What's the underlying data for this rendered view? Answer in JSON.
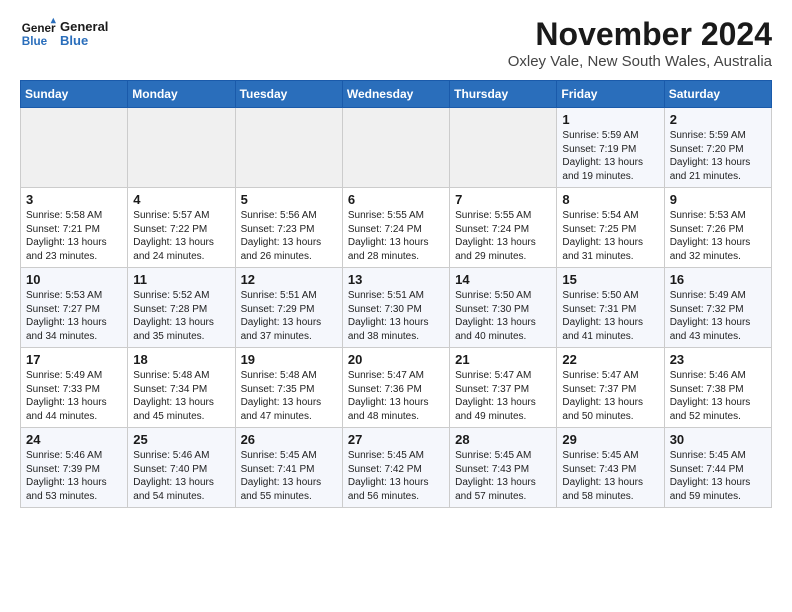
{
  "logo": {
    "line1": "General",
    "line2": "Blue"
  },
  "title": "November 2024",
  "location": "Oxley Vale, New South Wales, Australia",
  "headers": [
    "Sunday",
    "Monday",
    "Tuesday",
    "Wednesday",
    "Thursday",
    "Friday",
    "Saturday"
  ],
  "weeks": [
    [
      {
        "day": "",
        "info": ""
      },
      {
        "day": "",
        "info": ""
      },
      {
        "day": "",
        "info": ""
      },
      {
        "day": "",
        "info": ""
      },
      {
        "day": "",
        "info": ""
      },
      {
        "day": "1",
        "info": "Sunrise: 5:59 AM\nSunset: 7:19 PM\nDaylight: 13 hours\nand 19 minutes."
      },
      {
        "day": "2",
        "info": "Sunrise: 5:59 AM\nSunset: 7:20 PM\nDaylight: 13 hours\nand 21 minutes."
      }
    ],
    [
      {
        "day": "3",
        "info": "Sunrise: 5:58 AM\nSunset: 7:21 PM\nDaylight: 13 hours\nand 23 minutes."
      },
      {
        "day": "4",
        "info": "Sunrise: 5:57 AM\nSunset: 7:22 PM\nDaylight: 13 hours\nand 24 minutes."
      },
      {
        "day": "5",
        "info": "Sunrise: 5:56 AM\nSunset: 7:23 PM\nDaylight: 13 hours\nand 26 minutes."
      },
      {
        "day": "6",
        "info": "Sunrise: 5:55 AM\nSunset: 7:24 PM\nDaylight: 13 hours\nand 28 minutes."
      },
      {
        "day": "7",
        "info": "Sunrise: 5:55 AM\nSunset: 7:24 PM\nDaylight: 13 hours\nand 29 minutes."
      },
      {
        "day": "8",
        "info": "Sunrise: 5:54 AM\nSunset: 7:25 PM\nDaylight: 13 hours\nand 31 minutes."
      },
      {
        "day": "9",
        "info": "Sunrise: 5:53 AM\nSunset: 7:26 PM\nDaylight: 13 hours\nand 32 minutes."
      }
    ],
    [
      {
        "day": "10",
        "info": "Sunrise: 5:53 AM\nSunset: 7:27 PM\nDaylight: 13 hours\nand 34 minutes."
      },
      {
        "day": "11",
        "info": "Sunrise: 5:52 AM\nSunset: 7:28 PM\nDaylight: 13 hours\nand 35 minutes."
      },
      {
        "day": "12",
        "info": "Sunrise: 5:51 AM\nSunset: 7:29 PM\nDaylight: 13 hours\nand 37 minutes."
      },
      {
        "day": "13",
        "info": "Sunrise: 5:51 AM\nSunset: 7:30 PM\nDaylight: 13 hours\nand 38 minutes."
      },
      {
        "day": "14",
        "info": "Sunrise: 5:50 AM\nSunset: 7:30 PM\nDaylight: 13 hours\nand 40 minutes."
      },
      {
        "day": "15",
        "info": "Sunrise: 5:50 AM\nSunset: 7:31 PM\nDaylight: 13 hours\nand 41 minutes."
      },
      {
        "day": "16",
        "info": "Sunrise: 5:49 AM\nSunset: 7:32 PM\nDaylight: 13 hours\nand 43 minutes."
      }
    ],
    [
      {
        "day": "17",
        "info": "Sunrise: 5:49 AM\nSunset: 7:33 PM\nDaylight: 13 hours\nand 44 minutes."
      },
      {
        "day": "18",
        "info": "Sunrise: 5:48 AM\nSunset: 7:34 PM\nDaylight: 13 hours\nand 45 minutes."
      },
      {
        "day": "19",
        "info": "Sunrise: 5:48 AM\nSunset: 7:35 PM\nDaylight: 13 hours\nand 47 minutes."
      },
      {
        "day": "20",
        "info": "Sunrise: 5:47 AM\nSunset: 7:36 PM\nDaylight: 13 hours\nand 48 minutes."
      },
      {
        "day": "21",
        "info": "Sunrise: 5:47 AM\nSunset: 7:37 PM\nDaylight: 13 hours\nand 49 minutes."
      },
      {
        "day": "22",
        "info": "Sunrise: 5:47 AM\nSunset: 7:37 PM\nDaylight: 13 hours\nand 50 minutes."
      },
      {
        "day": "23",
        "info": "Sunrise: 5:46 AM\nSunset: 7:38 PM\nDaylight: 13 hours\nand 52 minutes."
      }
    ],
    [
      {
        "day": "24",
        "info": "Sunrise: 5:46 AM\nSunset: 7:39 PM\nDaylight: 13 hours\nand 53 minutes."
      },
      {
        "day": "25",
        "info": "Sunrise: 5:46 AM\nSunset: 7:40 PM\nDaylight: 13 hours\nand 54 minutes."
      },
      {
        "day": "26",
        "info": "Sunrise: 5:45 AM\nSunset: 7:41 PM\nDaylight: 13 hours\nand 55 minutes."
      },
      {
        "day": "27",
        "info": "Sunrise: 5:45 AM\nSunset: 7:42 PM\nDaylight: 13 hours\nand 56 minutes."
      },
      {
        "day": "28",
        "info": "Sunrise: 5:45 AM\nSunset: 7:43 PM\nDaylight: 13 hours\nand 57 minutes."
      },
      {
        "day": "29",
        "info": "Sunrise: 5:45 AM\nSunset: 7:43 PM\nDaylight: 13 hours\nand 58 minutes."
      },
      {
        "day": "30",
        "info": "Sunrise: 5:45 AM\nSunset: 7:44 PM\nDaylight: 13 hours\nand 59 minutes."
      }
    ]
  ]
}
